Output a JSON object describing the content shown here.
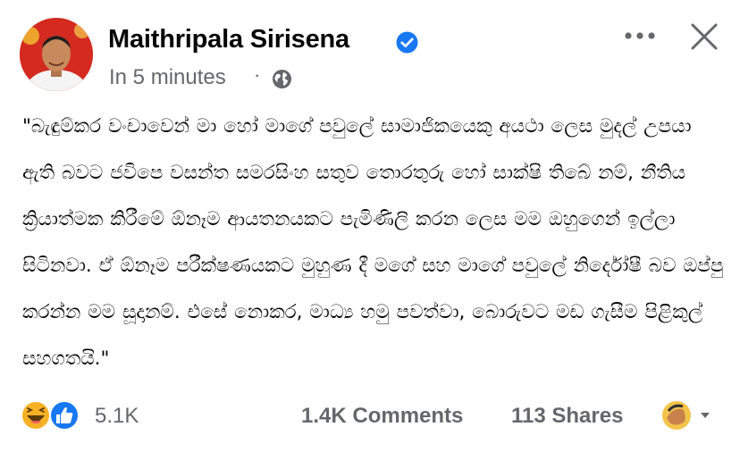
{
  "author": {
    "name": "Maithripala Sirisena",
    "avatar_icon": "profile-photo",
    "verified_icon": "verified-badge-icon",
    "verified_color": "#1877f2"
  },
  "meta": {
    "time": "In 5 minutes",
    "separator": "·",
    "audience_icon": "globe-icon"
  },
  "actions": {
    "more_icon": "more-options-icon",
    "close_icon": "close-icon"
  },
  "post": {
    "text": "\"බැඳුම්කර වංචාවෙන් මා හෝ මාගේ පවුලේ සාමාජිකයෙකු අයථා ලෙස මුදල් උපයා ඇති බවට ජවිපෙ වසන්ත සමරසිංහ සතුව තොරතුරු හෝ සාක්ෂි තිබේ නම්, නීතිය ක්‍රියාත්මක කිරීමේ ඕනෑම ආයතනයකට පැමිණිලි කරන ලෙස මම ඔහුගෙන් ඉල්ලා සිටිනවා. ඒ ඕනෑම පරීක්ෂණයකට මුහුණ දී මගේ සහ මාගේ පවුලේ නිර්දෝෂී බව ඔප්පු කරන්න මම සූදානම්. එසේ නොකර, මාධ්‍ය හමු පවත්වා, බොරුවට මඩ ගැසීම පිළිකුල් සහගතයි.\""
  },
  "engagement": {
    "reaction_icons": [
      "haha-reaction-icon",
      "like-reaction-icon"
    ],
    "reaction_count": "5.1K",
    "comments": "1.4K Comments",
    "shares": "113 Shares",
    "react_as_icon": "profile-reaction-selector-icon"
  },
  "colors": {
    "secondary_text": "#65676b",
    "like_blue": "#1877f2",
    "haha_yellow": "#f7b125"
  }
}
